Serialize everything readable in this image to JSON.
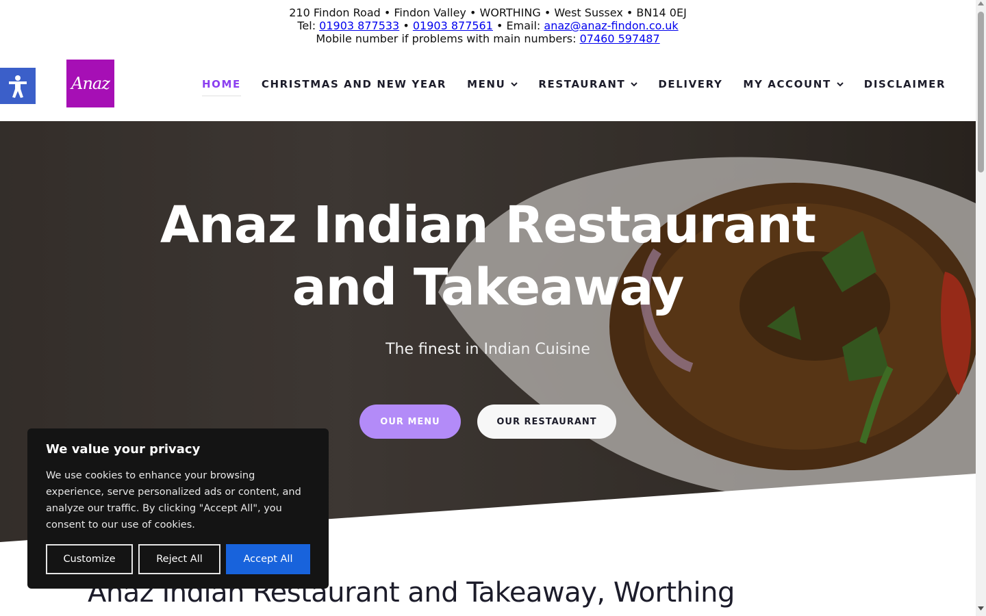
{
  "topbar": {
    "line1": "210 Findon Road • Findon Valley • WORTHING • West Sussex • BN14 0EJ",
    "tel_label": "Tel: ",
    "phone1": "01903 877533",
    "sep": " • ",
    "phone2": "01903 877561",
    "email_label": " • Email: ",
    "email": "anaz@anaz-findon.co.uk",
    "mobile_label": "Mobile number if problems with main numbers: ",
    "mobile": "07460 597487"
  },
  "header": {
    "logo_text": "Anaz",
    "nav": {
      "home": "HOME",
      "christmas": "CHRISTMAS AND NEW YEAR",
      "menu": "MENU",
      "restaurant": "RESTAURANT",
      "delivery": "DELIVERY",
      "account": "MY ACCOUNT",
      "disclaimer": "DISCLAIMER"
    }
  },
  "hero": {
    "title_line1": "Anaz Indian Restaurant",
    "title_line2": "and Takeaway",
    "subtitle": "The finest in Indian Cuisine",
    "btn_menu": "OUR MENU",
    "btn_restaurant": "OUR RESTAURANT"
  },
  "main": {
    "heading": "Anaz Indian Restaurant and Takeaway, Worthing"
  },
  "cookie": {
    "title": "We value your privacy",
    "text": "We use cookies to enhance your browsing experience, serve personalized ads or content, and analyze our traffic. By clicking \"Accept All\", you consent to our use of cookies.",
    "customize": "Customize",
    "reject": "Reject All",
    "accept": "Accept All"
  },
  "colors": {
    "accent": "#8b3ff0",
    "button_purple": "#b38bf8",
    "logo_bg": "#a60fb5",
    "accessibility_blue": "#3b5fc9",
    "accept_blue": "#1863dc"
  },
  "icons": {
    "accessibility": "accessibility-person-icon",
    "nav_dropdown": "chevron-down-icon"
  }
}
